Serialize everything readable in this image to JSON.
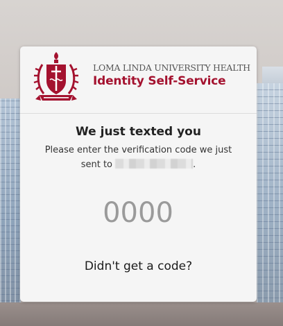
{
  "header": {
    "org_name": "LOMA LINDA UNIVERSITY HEALTH",
    "app_name": "Identity Self-Service",
    "logo": "university-seal-icon",
    "brand_color": "#a4122f"
  },
  "verification": {
    "heading": "We just texted you",
    "message_line1": "Please enter the verification code we just",
    "message_prefix": "sent to",
    "message_suffix": ".",
    "code_placeholder": "0000",
    "code_value": "",
    "resend_label": "Didn't get a code?"
  }
}
